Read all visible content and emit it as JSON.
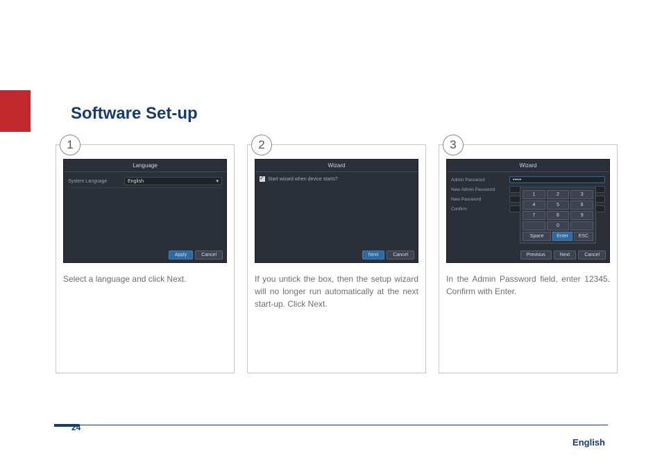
{
  "page": {
    "title": "Software Set-up",
    "number": "24",
    "language_footer": "English"
  },
  "steps": [
    {
      "num": "1",
      "screen_title": "Language",
      "lang_label": "System Language",
      "lang_value": "English",
      "buttons": {
        "apply": "Apply",
        "cancel": "Cancel"
      },
      "caption": "Select a language and click Next."
    },
    {
      "num": "2",
      "screen_title": "Wizard",
      "checkbox_label": "Start wizard when device starts?",
      "buttons": {
        "next": "Next",
        "cancel": "Cancel"
      },
      "caption": "If you untick the box, then the setup wizard will no longer run automatically at the next start-up. Click Next."
    },
    {
      "num": "3",
      "screen_title": "Wizard",
      "fields": {
        "admin_pwd_label": "Admin Password",
        "admin_pwd_value": "•••••",
        "new_admin_pwd_label": "New Admin Password",
        "new_pwd_label": "New Password",
        "confirm_label": "Confirm"
      },
      "keypad": {
        "rows": [
          [
            "1",
            "2",
            "3"
          ],
          [
            "4",
            "5",
            "6"
          ],
          [
            "7",
            "8",
            "9"
          ],
          [
            "",
            "0",
            ""
          ]
        ],
        "space": "Space",
        "enter": "Enter",
        "esc": "ESC"
      },
      "buttons": {
        "previous": "Previous",
        "next": "Next",
        "cancel": "Cancel"
      },
      "caption": "In the Admin Password field, enter 12345. Confirm with Enter."
    }
  ]
}
